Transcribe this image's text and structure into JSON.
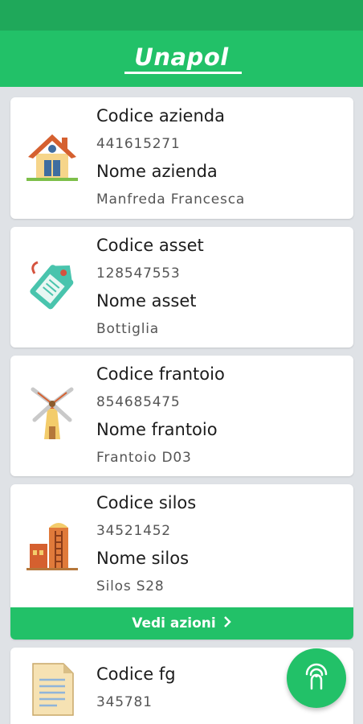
{
  "app": {
    "title": "Unapol"
  },
  "cards": [
    {
      "code_label": "Codice azienda",
      "code_value": "441615271",
      "name_label": "Nome azienda",
      "name_value": "Manfreda Francesca",
      "icon": "house-icon"
    },
    {
      "code_label": "Codice asset",
      "code_value": "128547553",
      "name_label": "Nome asset",
      "name_value": "Bottiglia",
      "icon": "tag-icon"
    },
    {
      "code_label": "Codice frantoio",
      "code_value": "854685475",
      "name_label": "Nome frantoio",
      "name_value": "Frantoio D03",
      "icon": "windmill-icon"
    },
    {
      "code_label": "Codice silos",
      "code_value": "34521452",
      "name_label": "Nome silos",
      "name_value": "Silos S28",
      "icon": "silo-icon",
      "action_label": "Vedi azioni"
    },
    {
      "code_label": "Codice fg",
      "code_value": "345781",
      "icon": "document-icon"
    }
  ],
  "fab": {
    "icon": "nfc-scan-icon"
  },
  "colors": {
    "primary": "#22c168",
    "status_bar": "#1fa85a",
    "background": "#dfe2e6"
  }
}
